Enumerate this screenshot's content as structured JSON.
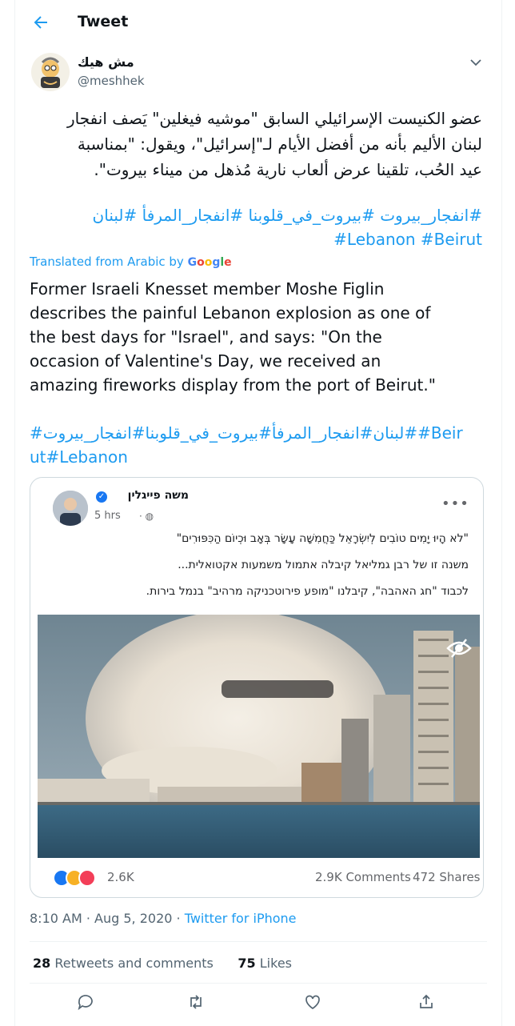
{
  "header": {
    "title": "Tweet"
  },
  "author": {
    "display_name": "مش هيك",
    "handle": "@meshhek"
  },
  "tweet": {
    "arabic_lines": [
      "عضو الكنيست الإسرائيلي السابق \"موشيه فيغلين\" يَصف انفجار",
      "لبنان الأليم بأنه من أفضل الأيام لـ\"إسرائيل\"، ويقول: \"بمناسبة",
      "عيد الحُب، تلقينا عرض ألعاب نارية مُذهل من ميناء بيروت\"."
    ],
    "arabic_hashtags": "#انفجار_بيروت #بيروت_في_قلوبنا #انفجار_المرفأ #لبنان",
    "english_hashtags": "#Lebanon #Beirut",
    "translated_label": "Translated from Arabic by",
    "google": [
      "G",
      "o",
      "o",
      "g",
      "l",
      "e"
    ],
    "translation_lines": [
      "Former Israeli Knesset member Moshe Figlin",
      "describes the painful Lebanon explosion as one of",
      "the best days for \"Israel\", and says: \"On the",
      "occasion of Valentine's Day, we received an",
      "amazing fireworks display from the port of Beirut.\""
    ],
    "translated_hashtags_lines": [
      "#لبنان#انفجار_المرفأ#بيروت_في_قلوبنا#انفجار_بيروت##Beir",
      "ut#Lebanon"
    ]
  },
  "fb_post": {
    "name": "משה פייגלין",
    "time": "5 hrs",
    "menu": "•••",
    "text_lines": [
      "\"לא הָיוּ יָמִים טוֹבִים לְיִשְׂרָאֵל כַּחֲמִשָּׁה עָשָׂר בְּאָב וּכְיוֹם הַכִּפּוּרִים\"",
      "משנה זו של רבן גמליאל קיבלה אתמול משמעות אקטואלית...",
      "לכבוד \"חג האהבה\", קיבלנו \"מופע פירוטכניקה מרהיב\" בנמל בירות."
    ],
    "reactions_count": "2.6K",
    "comments": "2.9K Comments",
    "shares": "472 Shares"
  },
  "meta": {
    "time": "8:10 AM",
    "sep": " · ",
    "date": "Aug 5, 2020",
    "source": "Twitter for iPhone"
  },
  "stats": {
    "retweets": "28",
    "retweets_label": "Retweets and comments",
    "likes": "75",
    "likes_label": "Likes"
  },
  "icons": {
    "back": "back-arrow-icon",
    "caret": "chevron-down-icon",
    "eye": "hidden-eye-icon",
    "reply": "reply-icon",
    "retweet": "retweet-icon",
    "like": "heart-icon",
    "share": "share-icon"
  },
  "colors": {
    "accent": "#1d9bf0",
    "text": "#0f1419",
    "muted": "#536471",
    "fb_blue": "#1877f2"
  }
}
